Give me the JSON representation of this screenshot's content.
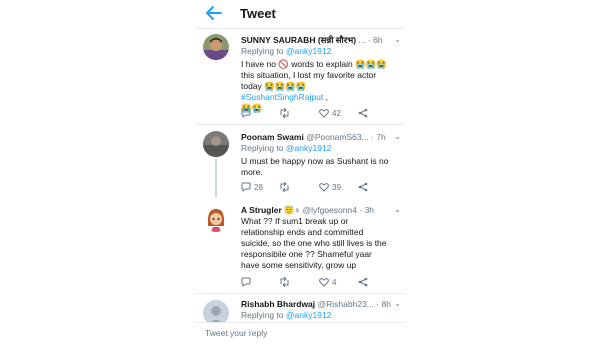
{
  "header": {
    "title": "Tweet"
  },
  "tweets": [
    {
      "name": "SUNNY SAURABH (सन्नी सौरभ)",
      "ellipsis": "...",
      "handle": "",
      "time": "6h",
      "reply_prefix": "Replying to",
      "reply_to": "@anky1912",
      "text_1": "I have no 🚫 words to explain 😭😭😭 this situation, I lost my favorite actor today 😭😭😭😭",
      "hashtag": "#SushantSinghRajput",
      "text_2": ",",
      "text_3": "😭😭",
      "replies": "",
      "retweets": "",
      "likes": "42"
    },
    {
      "name": "Poonam Swami",
      "handle": "@PoonamS63...",
      "time": "7h",
      "reply_prefix": "Replying to",
      "reply_to": "@anky1912",
      "text_1": "U must be happy now as Sushant is no more.",
      "replies": "28",
      "retweets": "",
      "likes": "39"
    },
    {
      "name": "A Strugler",
      "name_emoji": "😇♀",
      "handle": "@lyfgoesonn4",
      "time": "3h",
      "text_1": "What ?? If sum1 break up or relationship ends and committed suicide, so the one who still lives is the responsibile one ?? Shameful yaar have some sensitivity, grow up",
      "replies": "",
      "retweets": "",
      "likes": "4"
    },
    {
      "name": "Rishabh Bhardwaj",
      "handle": "@Rishabh23...",
      "time": "8h",
      "reply_prefix": "Replying to",
      "reply_to": "@anky1912"
    }
  ],
  "reply_bar": {
    "placeholder": "Tweet your reply"
  },
  "colors": {
    "accent": "#1da1f2",
    "muted": "#657786",
    "divider": "#e6ecf0"
  }
}
